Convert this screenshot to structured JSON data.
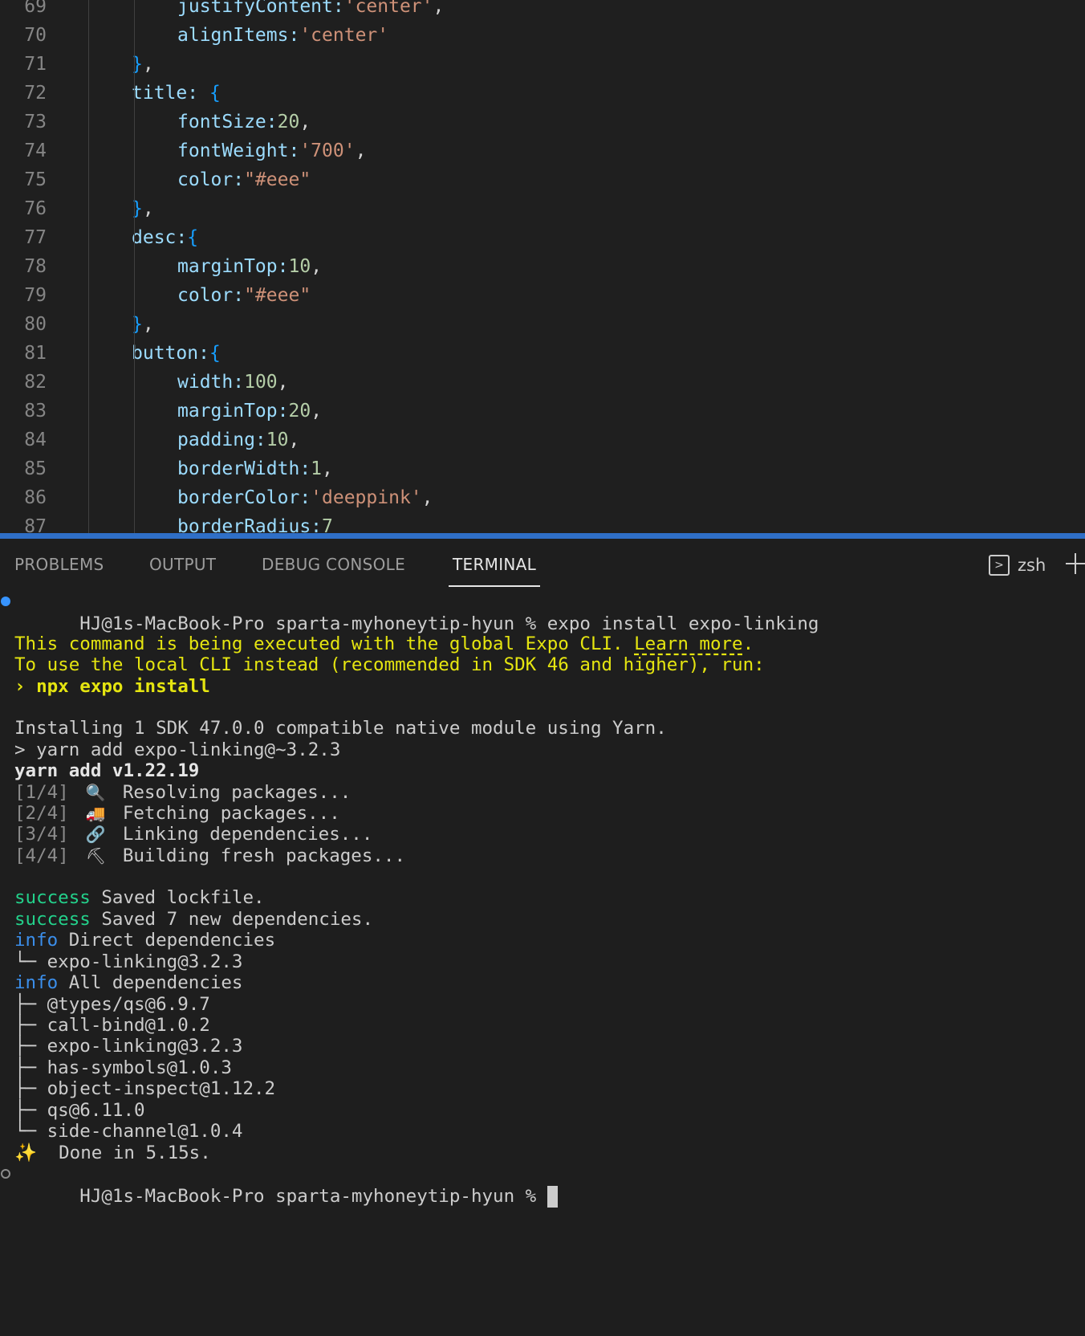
{
  "editor": {
    "lines": [
      {
        "n": "69",
        "indent": 3,
        "tokens": [
          [
            "justifyContent:",
            "k"
          ],
          [
            "'center'",
            "s"
          ],
          [
            ",",
            "p"
          ]
        ]
      },
      {
        "n": "70",
        "indent": 3,
        "tokens": [
          [
            "alignItems:",
            "k"
          ],
          [
            "'center'",
            "s"
          ]
        ]
      },
      {
        "n": "71",
        "indent": 2,
        "tokens": [
          [
            "}",
            "b"
          ],
          [
            ",",
            "p"
          ]
        ]
      },
      {
        "n": "72",
        "indent": 2,
        "tokens": [
          [
            "title: ",
            "k"
          ],
          [
            "{",
            "b"
          ]
        ]
      },
      {
        "n": "73",
        "indent": 3,
        "tokens": [
          [
            "fontSize:",
            "k"
          ],
          [
            "20",
            "n"
          ],
          [
            ",",
            "p"
          ]
        ]
      },
      {
        "n": "74",
        "indent": 3,
        "tokens": [
          [
            "fontWeight:",
            "k"
          ],
          [
            "'700'",
            "s"
          ],
          [
            ",",
            "p"
          ]
        ]
      },
      {
        "n": "75",
        "indent": 3,
        "tokens": [
          [
            "color:",
            "k"
          ],
          [
            "\"#eee\"",
            "s"
          ]
        ]
      },
      {
        "n": "76",
        "indent": 2,
        "tokens": [
          [
            "}",
            "b"
          ],
          [
            ",",
            "p"
          ]
        ]
      },
      {
        "n": "77",
        "indent": 2,
        "tokens": [
          [
            "desc:",
            "k"
          ],
          [
            "{",
            "b"
          ]
        ]
      },
      {
        "n": "78",
        "indent": 3,
        "tokens": [
          [
            "marginTop:",
            "k"
          ],
          [
            "10",
            "n"
          ],
          [
            ",",
            "p"
          ]
        ]
      },
      {
        "n": "79",
        "indent": 3,
        "tokens": [
          [
            "color:",
            "k"
          ],
          [
            "\"#eee\"",
            "s"
          ]
        ]
      },
      {
        "n": "80",
        "indent": 2,
        "tokens": [
          [
            "}",
            "b"
          ],
          [
            ",",
            "p"
          ]
        ]
      },
      {
        "n": "81",
        "indent": 2,
        "tokens": [
          [
            "button:",
            "k"
          ],
          [
            "{",
            "b"
          ]
        ]
      },
      {
        "n": "82",
        "indent": 3,
        "tokens": [
          [
            "width:",
            "k"
          ],
          [
            "100",
            "n"
          ],
          [
            ",",
            "p"
          ]
        ]
      },
      {
        "n": "83",
        "indent": 3,
        "tokens": [
          [
            "marginTop:",
            "k"
          ],
          [
            "20",
            "n"
          ],
          [
            ",",
            "p"
          ]
        ]
      },
      {
        "n": "84",
        "indent": 3,
        "tokens": [
          [
            "padding:",
            "k"
          ],
          [
            "10",
            "n"
          ],
          [
            ",",
            "p"
          ]
        ]
      },
      {
        "n": "85",
        "indent": 3,
        "tokens": [
          [
            "borderWidth:",
            "k"
          ],
          [
            "1",
            "n"
          ],
          [
            ",",
            "p"
          ]
        ]
      },
      {
        "n": "86",
        "indent": 3,
        "tokens": [
          [
            "borderColor:",
            "k"
          ],
          [
            "'deeppink'",
            "s"
          ],
          [
            ",",
            "p"
          ]
        ]
      },
      {
        "n": "87",
        "indent": 3,
        "tokens": [
          [
            "borderRadius:",
            "k"
          ],
          [
            "7",
            "n"
          ]
        ]
      }
    ]
  },
  "panel": {
    "tabs": [
      {
        "id": "problems",
        "label": "PROBLEMS"
      },
      {
        "id": "output",
        "label": "OUTPUT"
      },
      {
        "id": "debug-console",
        "label": "DEBUG CONSOLE"
      },
      {
        "id": "terminal",
        "label": "TERMINAL",
        "active": true
      }
    ],
    "terminal_name": "zsh"
  },
  "terminal": {
    "prompt": "HJ@1s-MacBook-Pro sparta-myhoneytip-hyun % ",
    "command": "expo install expo-linking",
    "warning_line1_pre": "This command is being executed with the global Expo CLI. ",
    "warning_link": "Learn more",
    "warning_line1_post": ".",
    "warning_line2": "To use the local CLI instead (recommended in SDK 46 and higher), run:",
    "warning_cmd_prefix": "› ",
    "warning_cmd": "npx expo install",
    "installing": "Installing 1 SDK 47.0.0 compatible native module using Yarn.",
    "yarn_cmd": "> yarn add expo-linking@~3.2.3",
    "yarn_version": "yarn add v1.22.19",
    "steps": [
      {
        "step": "[1/4]",
        "emoji": "🔍",
        "text": "Resolving packages..."
      },
      {
        "step": "[2/4]",
        "emoji": "🚚",
        "text": "Fetching packages..."
      },
      {
        "step": "[3/4]",
        "emoji": "🔗",
        "text": "Linking dependencies..."
      },
      {
        "step": "[4/4]",
        "emoji": "⛏",
        "text": "Building fresh packages..."
      }
    ],
    "success1_tag": "success",
    "success1_text": " Saved lockfile.",
    "success2_tag": "success",
    "success2_text": " Saved 7 new dependencies.",
    "info1_tag": "info",
    "info1_text": " Direct dependencies",
    "direct_dep": "└─ expo-linking@3.2.3",
    "info2_tag": "info",
    "info2_text": " All dependencies",
    "all_deps": [
      "├─ @types/qs@6.9.7",
      "├─ call-bind@1.0.2",
      "├─ expo-linking@3.2.3",
      "├─ has-symbols@1.0.3",
      "├─ object-inspect@1.12.2",
      "├─ qs@6.11.0",
      "└─ side-channel@1.0.4"
    ],
    "done_emoji": "✨",
    "done_text": "  Done in 5.15s.",
    "final_prompt": "HJ@1s-MacBook-Pro sparta-myhoneytip-hyun % "
  }
}
